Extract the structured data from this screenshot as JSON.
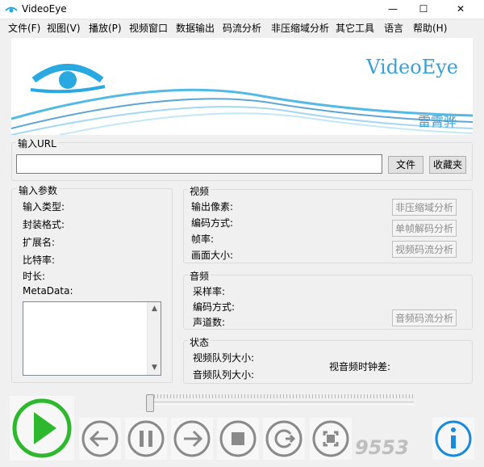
{
  "window": {
    "title": "VideoEye",
    "minimize": "—",
    "maximize": "☐",
    "close": "✕"
  },
  "menu": [
    "文件(F)",
    "视图(V)",
    "播放(P)",
    "视频窗口",
    "数据输出",
    "码流分析",
    "非压缩域分析",
    "其它工具",
    "语言",
    "帮助(H)"
  ],
  "banner": {
    "brand": "VideoEye",
    "author": "雷霄骅"
  },
  "url_group": {
    "label": "输入URL",
    "value": "",
    "file_button": "文件",
    "favorites_button": "收藏夹"
  },
  "input_params": {
    "label": "输入参数",
    "fields": [
      "输入类型:",
      "封装格式:",
      "扩展名:",
      "比特率:",
      "时长:",
      "MetaData:"
    ],
    "metadata_text": ""
  },
  "video": {
    "label": "视频",
    "fields": [
      "输出像素:",
      "编码方式:",
      "帧率:",
      "画面大小:"
    ],
    "buttons": [
      "非压缩域分析",
      "单帧解码分析",
      "视频码流分析"
    ]
  },
  "audio": {
    "label": "音频",
    "fields": [
      "采样率:",
      "编码方式:",
      "声道数:"
    ],
    "button": "音频码流分析"
  },
  "status": {
    "label": "状态",
    "video_queue": "视频队列大小:",
    "audio_queue": "音频队列大小:",
    "av_diff": "视音频时钟差:"
  },
  "playback": {
    "position_fraction": 0.0,
    "controls": [
      "play-icon",
      "previous-icon",
      "pause-icon",
      "next-icon",
      "stop-icon",
      "refresh-icon",
      "fullscreen-icon",
      "info-icon"
    ]
  },
  "watermark": "9553",
  "colors": {
    "accent": "#2aa8e0",
    "play": "#2db82d",
    "info": "#1a8bd8"
  }
}
